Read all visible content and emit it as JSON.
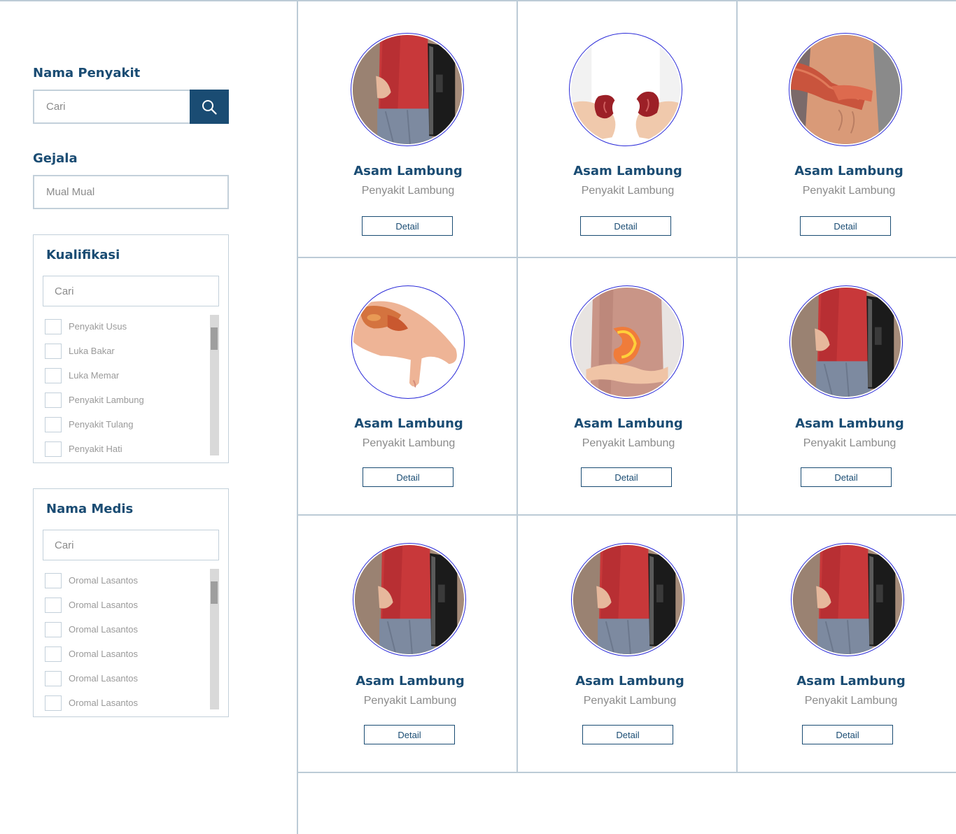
{
  "filters": {
    "nama_penyakit": {
      "label": "Nama Penyakit",
      "placeholder": "Cari"
    },
    "gejala": {
      "label": "Gejala",
      "placeholder": "Mual Mual"
    },
    "kualifikasi": {
      "title": "Kualifikasi",
      "search_placeholder": "Cari",
      "options": [
        "Penyakit Usus",
        "Luka Bakar",
        "Luka Memar",
        "Penyakit Lambung",
        "Penyakit Tulang",
        "Penyakit Hati"
      ]
    },
    "nama_medis": {
      "title": "Nama Medis",
      "search_placeholder": "Cari",
      "options": [
        "Oromal Lasantos",
        "Oromal Lasantos",
        "Oromal Lasantos",
        "Oromal Lasantos",
        "Oromal Lasantos",
        "Oromal Lasantos"
      ]
    }
  },
  "cards": [
    {
      "title": "Asam Lambung",
      "subtitle": "Penyakit Lambung",
      "button": "Detail",
      "image": "stomach-red-shirt-photo"
    },
    {
      "title": "Asam Lambung",
      "subtitle": "Penyakit Lambung",
      "button": "Detail",
      "image": "kidneys-in-hands-photo"
    },
    {
      "title": "Asam Lambung",
      "subtitle": "Penyakit Lambung",
      "button": "Detail",
      "image": "arm-muscle-pain-photo"
    },
    {
      "title": "Asam Lambung",
      "subtitle": "Penyakit Lambung",
      "button": "Detail",
      "image": "burned-hand-photo"
    },
    {
      "title": "Asam Lambung",
      "subtitle": "Penyakit Lambung",
      "button": "Detail",
      "image": "stomach-illustration-photo"
    },
    {
      "title": "Asam Lambung",
      "subtitle": "Penyakit Lambung",
      "button": "Detail",
      "image": "stomach-red-shirt-photo"
    },
    {
      "title": "Asam Lambung",
      "subtitle": "Penyakit Lambung",
      "button": "Detail",
      "image": "stomach-red-shirt-photo"
    },
    {
      "title": "Asam Lambung",
      "subtitle": "Penyakit Lambung",
      "button": "Detail",
      "image": "stomach-red-shirt-photo"
    },
    {
      "title": "Asam Lambung",
      "subtitle": "Penyakit Lambung",
      "button": "Detail",
      "image": "stomach-red-shirt-photo"
    }
  ],
  "colors": {
    "primary": "#1a4c73",
    "border": "#c3d0da",
    "muted_text": "#8b8b8b",
    "avatar_ring": "#2a2ad8"
  }
}
